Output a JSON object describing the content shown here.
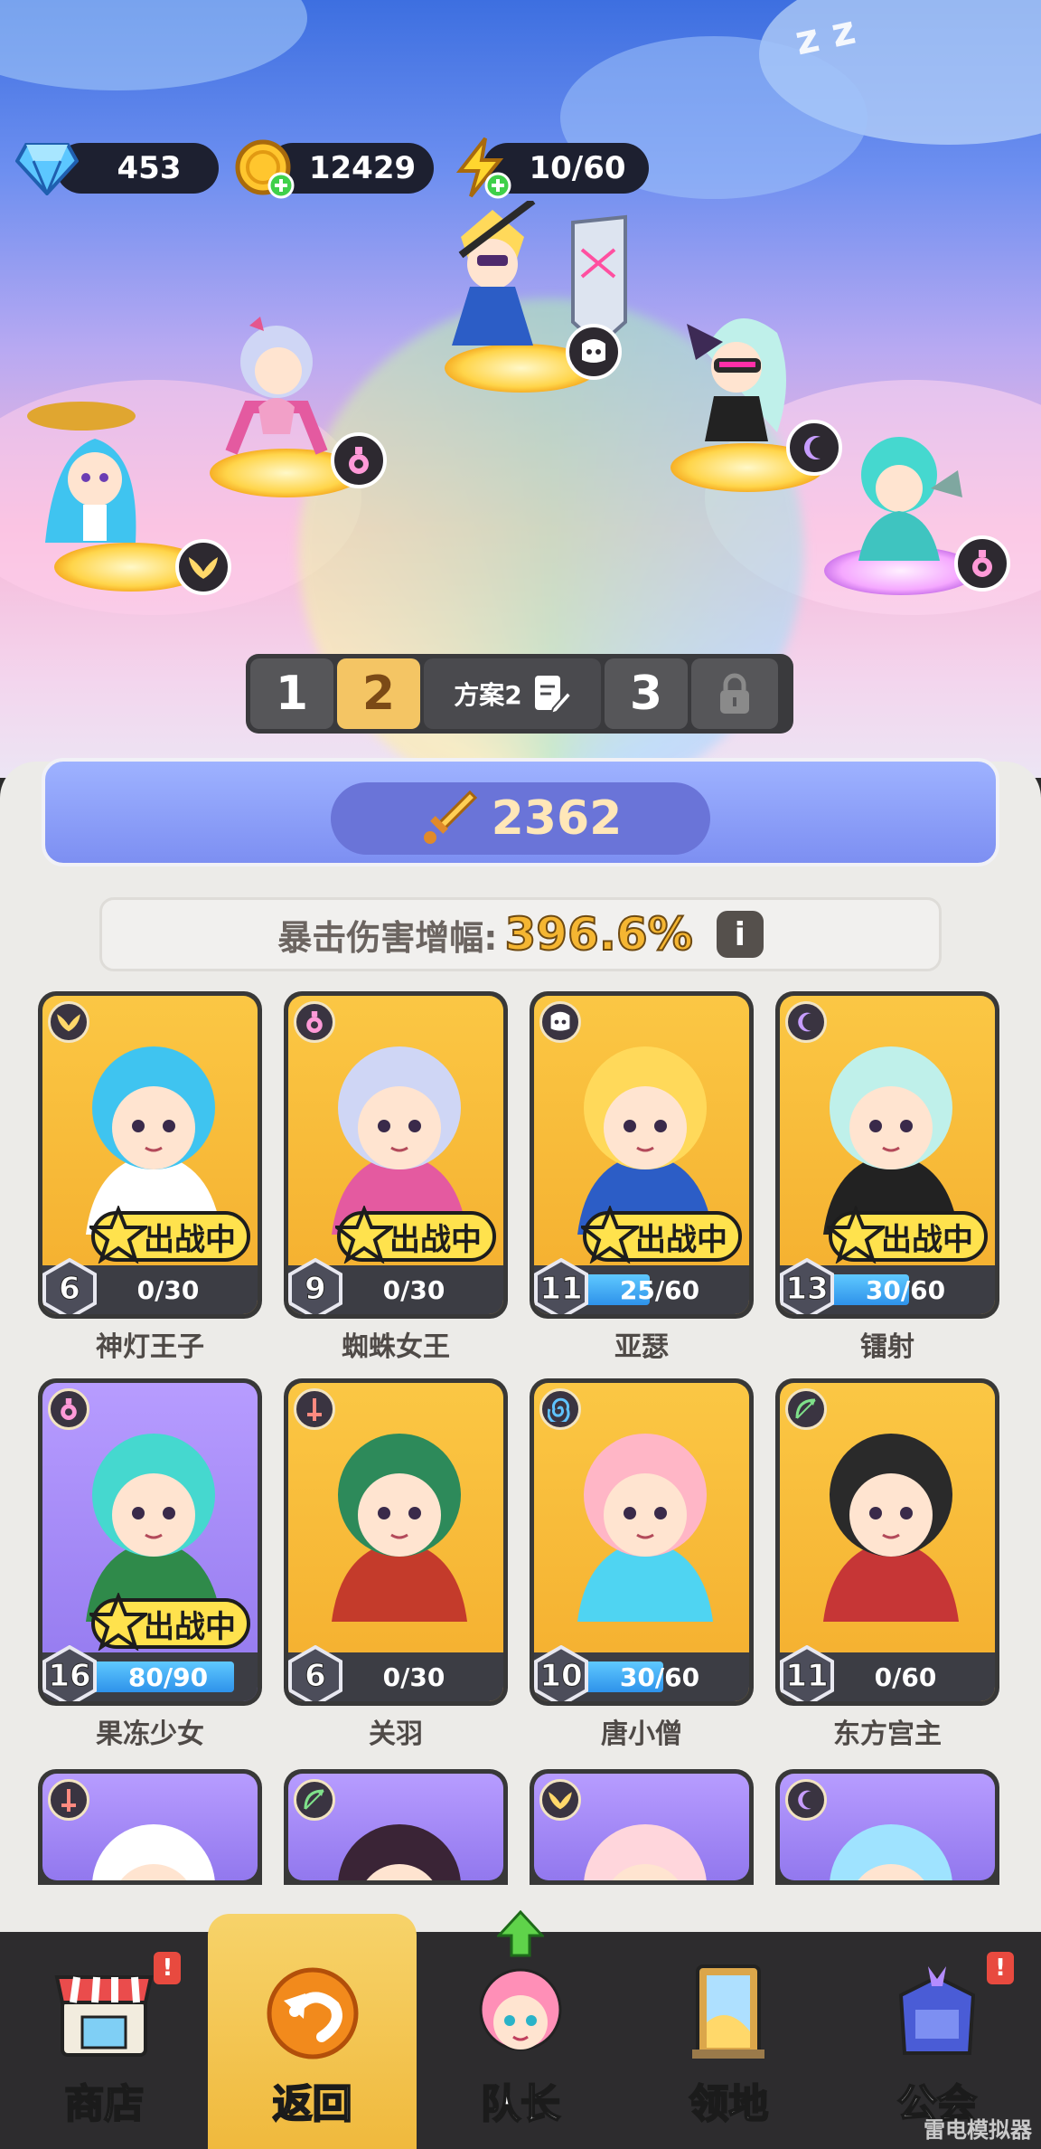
{
  "resources": {
    "diamonds": "453",
    "coins": "12429",
    "energy": "10/60"
  },
  "plans": {
    "tabs": [
      "1",
      "2",
      "3"
    ],
    "active": "2",
    "current_plan_name": "方案2"
  },
  "team": {
    "power": "2362",
    "crit_label": "暴击伤害增幅:",
    "crit_value": "396.6%"
  },
  "deployed_label": "出战中",
  "cards": [
    {
      "name": "神灯王子",
      "level": "6",
      "progress_text": "0/30",
      "progress": 0.0,
      "deployed": true,
      "class_icon": "wings-icon",
      "bg": "orange"
    },
    {
      "name": "蜘蛛女王",
      "level": "9",
      "progress_text": "0/30",
      "progress": 0.0,
      "deployed": true,
      "class_icon": "potion-icon",
      "bg": "orange"
    },
    {
      "name": "亚瑟",
      "level": "11",
      "progress_text": "25/60",
      "progress": 0.4167,
      "deployed": true,
      "class_icon": "helmet-icon",
      "bg": "orange"
    },
    {
      "name": "镭射",
      "level": "13",
      "progress_text": "30/60",
      "progress": 0.5,
      "deployed": true,
      "class_icon": "crescent-icon",
      "bg": "orange"
    },
    {
      "name": "果冻少女",
      "level": "16",
      "progress_text": "80/90",
      "progress": 0.8889,
      "deployed": true,
      "class_icon": "potion-icon",
      "bg": "purple"
    },
    {
      "name": "关羽",
      "level": "6",
      "progress_text": "0/30",
      "progress": 0.0,
      "deployed": false,
      "class_icon": "sword-icon",
      "bg": "orange"
    },
    {
      "name": "唐小僧",
      "level": "10",
      "progress_text": "30/60",
      "progress": 0.5,
      "deployed": false,
      "class_icon": "spiral-icon",
      "bg": "orange"
    },
    {
      "name": "东方宫主",
      "level": "11",
      "progress_text": "0/60",
      "progress": 0.0,
      "deployed": false,
      "class_icon": "bow-icon",
      "bg": "orange"
    },
    {
      "name": "",
      "level": "",
      "progress_text": "",
      "progress": 0,
      "deployed": false,
      "class_icon": "sword-icon",
      "bg": "purple"
    },
    {
      "name": "",
      "level": "",
      "progress_text": "",
      "progress": 0,
      "deployed": false,
      "class_icon": "bow-icon",
      "bg": "purple"
    },
    {
      "name": "",
      "level": "",
      "progress_text": "",
      "progress": 0,
      "deployed": false,
      "class_icon": "wings-icon",
      "bg": "purple"
    },
    {
      "name": "",
      "level": "",
      "progress_text": "",
      "progress": 0,
      "deployed": false,
      "class_icon": "crescent-icon",
      "bg": "purple"
    }
  ],
  "nav": [
    {
      "label": "商店",
      "icon": "shop-icon",
      "alert": "!"
    },
    {
      "label": "返回",
      "icon": "return-icon",
      "active": true
    },
    {
      "label": "队长",
      "icon": "captain-icon",
      "upgrade": true
    },
    {
      "label": "领地",
      "icon": "territory-icon"
    },
    {
      "label": "公会",
      "icon": "guild-icon",
      "alert": "!"
    }
  ],
  "watermark": "雷电模拟器",
  "colors": {
    "card_orange": "#f4ae2e",
    "card_purple": "#9278ee",
    "progress_blue": "#2e92ea",
    "nav_active": "#f0b93d"
  }
}
